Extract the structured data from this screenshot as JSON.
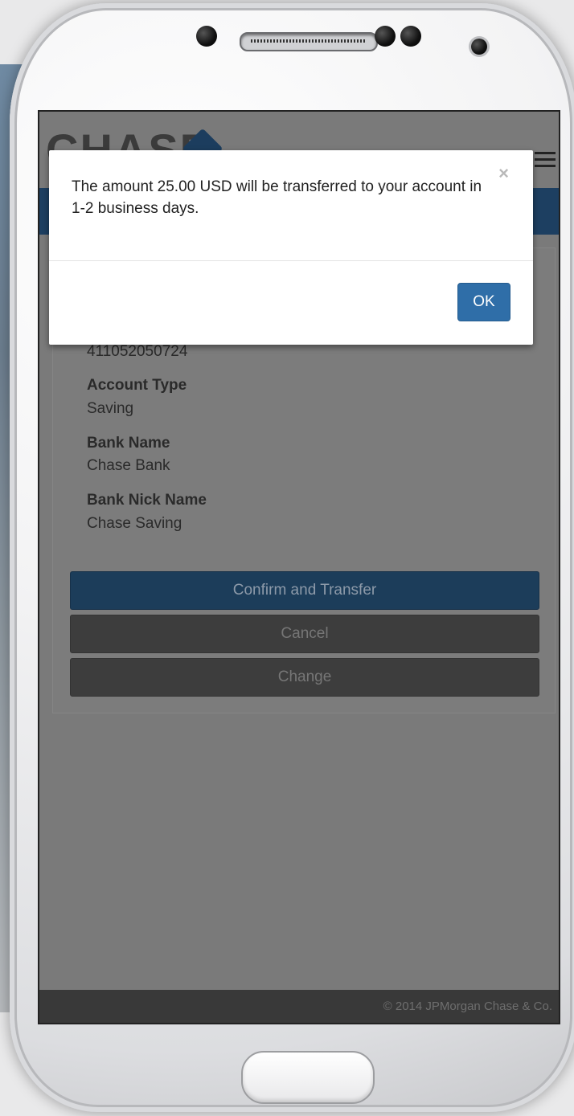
{
  "modal": {
    "message": "The amount 25.00 USD will be transferred to your account in 1-2 business days.",
    "close_glyph": "×",
    "ok_label": "OK"
  },
  "header": {
    "logo_text": "CHASE",
    "menu_icon": "hamburger-icon"
  },
  "details": {
    "account_number": "411052050724",
    "fields": [
      {
        "label": "Account Type",
        "value": "Saving"
      },
      {
        "label": "Bank Name",
        "value": "Chase Bank"
      },
      {
        "label": "Bank Nick Name",
        "value": "Chase Saving"
      }
    ]
  },
  "actions": {
    "confirm_label": "Confirm and Transfer",
    "cancel_label": "Cancel",
    "change_label": "Change"
  },
  "footer": {
    "copyright": "© 2014 JPMorgan Chase & Co."
  },
  "colors": {
    "brand_blue": "#1d3f61",
    "ok_button": "#2f6ea8",
    "overlay_grey": "#7a7a7a"
  }
}
